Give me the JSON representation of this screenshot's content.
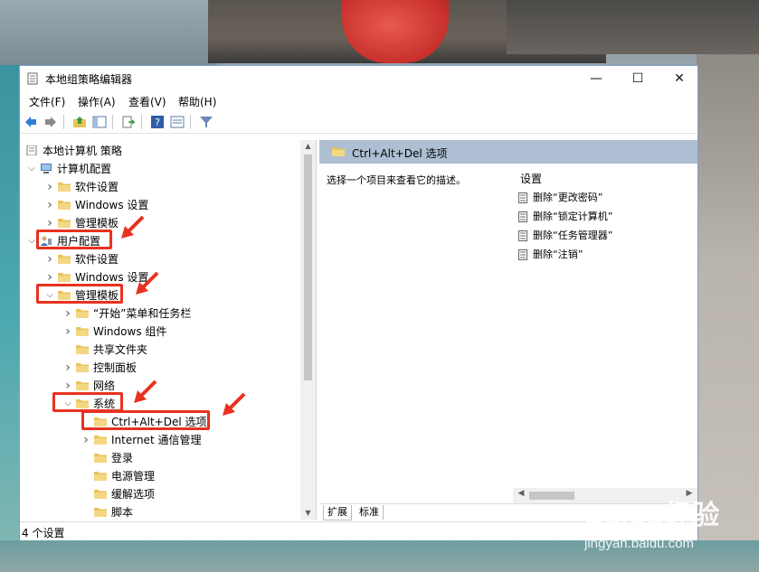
{
  "window": {
    "title": "本地组策略编辑器",
    "minimize": "—",
    "maximize": "☐",
    "close": "✕"
  },
  "menu": [
    "文件(F)",
    "操作(A)",
    "查看(V)",
    "帮助(H)"
  ],
  "toolbar": [
    "back-arrow-icon",
    "forward-arrow-icon",
    "folder-up-icon",
    "show-hide-tree-icon",
    "export-list-icon",
    "help-icon",
    "properties-icon",
    "filter-icon"
  ],
  "tree": [
    {
      "label": "本地计算机 策略",
      "level": 0,
      "expander": "",
      "icon": "policy-icon"
    },
    {
      "label": "计算机配置",
      "level": 1,
      "expander": "v",
      "icon": "computer-icon"
    },
    {
      "label": "软件设置",
      "level": 2,
      "expander": ">",
      "icon": "folder-icon"
    },
    {
      "label": "Windows 设置",
      "level": 2,
      "expander": ">",
      "icon": "folder-icon"
    },
    {
      "label": "管理模板",
      "level": 2,
      "expander": ">",
      "icon": "folder-icon"
    },
    {
      "label": "用户配置",
      "level": 1,
      "expander": "v",
      "icon": "user-icon"
    },
    {
      "label": "软件设置",
      "level": 2,
      "expander": ">",
      "icon": "folder-icon"
    },
    {
      "label": "Windows 设置",
      "level": 2,
      "expander": ">",
      "icon": "folder-icon"
    },
    {
      "label": "管理模板",
      "level": 2,
      "expander": "v",
      "icon": "folder-icon"
    },
    {
      "label": "“开始”菜单和任务栏",
      "level": 3,
      "expander": ">",
      "icon": "folder-icon"
    },
    {
      "label": "Windows 组件",
      "level": 3,
      "expander": ">",
      "icon": "folder-icon"
    },
    {
      "label": "共享文件夹",
      "level": 3,
      "expander": "",
      "icon": "folder-icon"
    },
    {
      "label": "控制面板",
      "level": 3,
      "expander": ">",
      "icon": "folder-icon"
    },
    {
      "label": "网络",
      "level": 3,
      "expander": ">",
      "icon": "folder-icon"
    },
    {
      "label": "系统",
      "level": 3,
      "expander": "v",
      "icon": "folder-icon"
    },
    {
      "label": "Ctrl+Alt+Del 选项",
      "level": 4,
      "expander": "",
      "icon": "folder-icon"
    },
    {
      "label": "Internet 通信管理",
      "level": 4,
      "expander": ">",
      "icon": "folder-icon"
    },
    {
      "label": "登录",
      "level": 4,
      "expander": "",
      "icon": "folder-icon"
    },
    {
      "label": "电源管理",
      "level": 4,
      "expander": "",
      "icon": "folder-icon"
    },
    {
      "label": "缓解选项",
      "level": 4,
      "expander": "",
      "icon": "folder-icon"
    },
    {
      "label": "脚本",
      "level": 4,
      "expander": "",
      "icon": "folder-icon"
    }
  ],
  "right": {
    "header": "Ctrl+Alt+Del 选项",
    "description": "选择一个项目来查看它的描述。",
    "settings_header": "设置",
    "settings": [
      "删除“更改密码”",
      "删除“锁定计算机”",
      "删除“任务管理器”",
      "删除“注销”"
    ],
    "tabs": [
      "扩展",
      "标准"
    ]
  },
  "status": "4 个设置",
  "watermark": {
    "brand": "Baidu经验",
    "sub": "jingyan.baidu.com"
  },
  "colors": {
    "highlight": "#e8321f",
    "header_bg": "#aebfd3",
    "folder": "#e8c35a"
  }
}
